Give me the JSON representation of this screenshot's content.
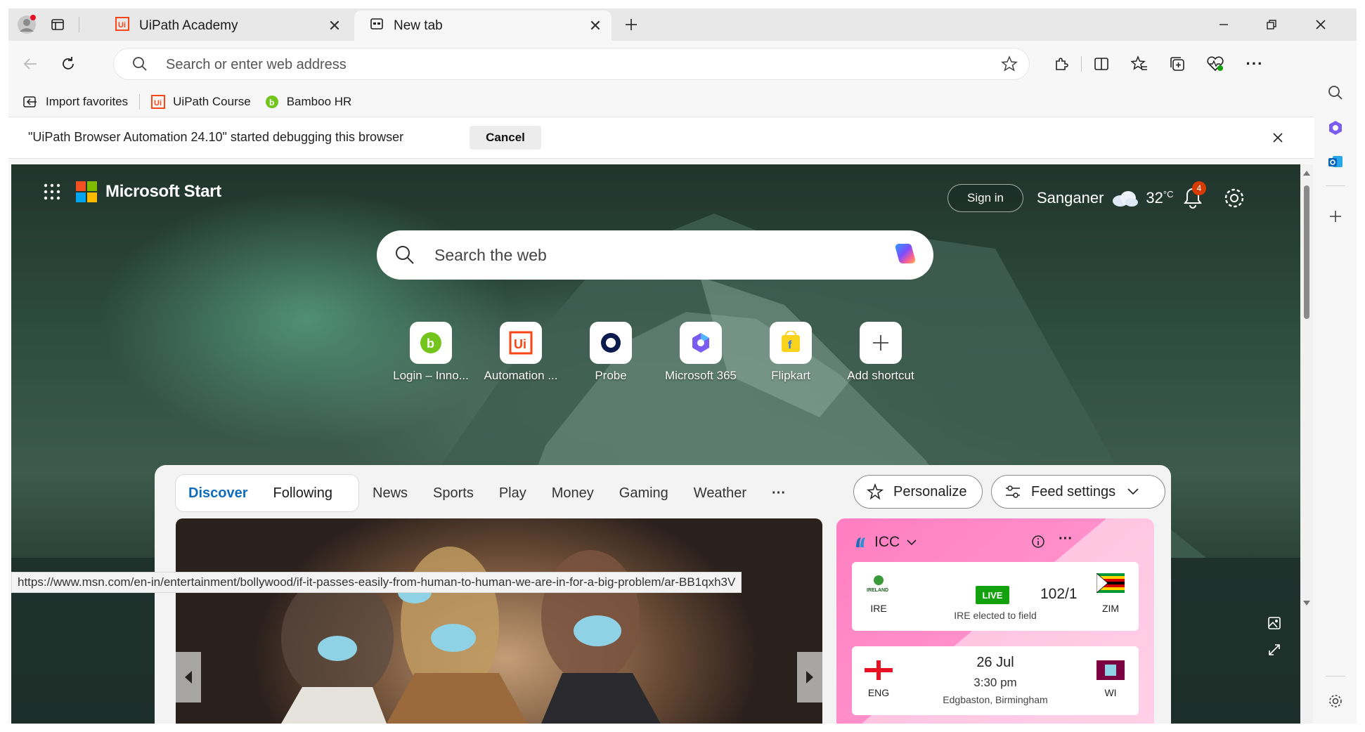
{
  "browser": {
    "tabs": [
      {
        "title": "UiPath Academy",
        "active": false
      },
      {
        "title": "New tab",
        "active": true
      }
    ],
    "address_bar": {
      "placeholder": "Search or enter web address",
      "value": ""
    },
    "favorites": [
      {
        "label": "Import favorites",
        "icon": "import-favorites-icon"
      },
      {
        "label": "UiPath Course",
        "icon": "uipath-icon"
      },
      {
        "label": "Bamboo HR",
        "icon": "bamboo-icon"
      }
    ],
    "infobar": {
      "message": "\"UiPath Browser Automation 24.10\" started debugging this browser",
      "cancel_label": "Cancel"
    }
  },
  "newtab": {
    "brand": "Microsoft Start",
    "sign_in": "Sign in",
    "location": "Sanganer",
    "temperature": "32",
    "temp_unit": "°C",
    "notification_count": "4",
    "search_placeholder": "Search the web",
    "shortcuts": [
      {
        "label": "Login – Inno...",
        "icon": "bamboo-icon"
      },
      {
        "label": "Automation ...",
        "icon": "uipath-icon"
      },
      {
        "label": "Probe",
        "icon": "probe-icon"
      },
      {
        "label": "Microsoft 365",
        "icon": "m365-icon"
      },
      {
        "label": "Flipkart",
        "icon": "flipkart-icon"
      },
      {
        "label": "Add shortcut",
        "icon": "plus-icon"
      }
    ],
    "feed": {
      "primary_tabs": [
        "Discover",
        "Following"
      ],
      "categories": [
        "News",
        "Sports",
        "Play",
        "Money",
        "Gaming",
        "Weather"
      ],
      "more": "···",
      "personalize": "Personalize",
      "feed_settings": "Feed settings"
    },
    "cricket": {
      "league": "ICC",
      "matches": [
        {
          "team1": "IRE",
          "team2": "ZIM",
          "status": "LIVE",
          "score": "102/1",
          "note": "IRE elected to field"
        },
        {
          "team1": "ENG",
          "team2": "WI",
          "date": "26 Jul",
          "time": "3:30 pm",
          "venue": "Edgbaston, Birmingham"
        }
      ]
    },
    "status_url": "https://www.msn.com/en-in/entertainment/bollywood/if-it-passes-easily-from-human-to-human-we-are-in-for-a-big-problem/ar-BB1qxh3V"
  },
  "colors": {
    "accent": "#0f6cbd",
    "live": "#13a10e",
    "badge": "#d83b01",
    "uipath": "#fa4616"
  }
}
